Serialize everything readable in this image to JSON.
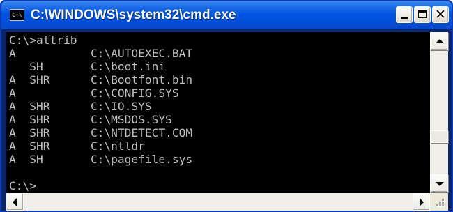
{
  "window": {
    "title": "C:\\WINDOWS\\system32\\cmd.exe",
    "icon": "cmd-app-icon",
    "icon_text": "C:\\",
    "controls": {
      "minimize": "minimize-icon",
      "maximize": "maximize-icon",
      "close": "close-icon",
      "close_glyph": "✕"
    }
  },
  "console": {
    "background": "#000000",
    "text_color": "#c0c0c0",
    "lines": [
      "C:\\>attrib",
      "A           C:\\AUTOEXEC.BAT",
      "   SH       C:\\boot.ini",
      "A  SHR      C:\\Bootfont.bin",
      "A           C:\\CONFIG.SYS",
      "A  SHR      C:\\IO.SYS",
      "A  SHR      C:\\MSDOS.SYS",
      "A  SHR      C:\\NTDETECT.COM",
      "A  SHR      C:\\ntldr",
      "A  SH       C:\\pagefile.sys",
      "",
      "C:\\>"
    ]
  },
  "scrollbars": {
    "vertical": {
      "up": "scroll-up-arrow-icon",
      "down": "scroll-down-arrow-icon"
    },
    "horizontal": {
      "left": "scroll-left-arrow-icon",
      "right": "scroll-right-arrow-icon"
    }
  },
  "colors": {
    "titlebar": "#0054e3",
    "title_text": "#ffffff",
    "close_button": "#f1eee4"
  }
}
